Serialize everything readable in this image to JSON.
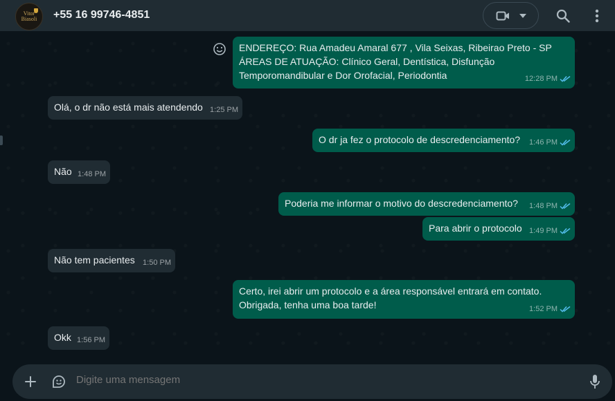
{
  "header": {
    "avatar_text": [
      "Vitor",
      "Biasoli"
    ],
    "contact_name": "+55 16 99746-4851",
    "icons": [
      "video-call-icon",
      "chevron-down-icon",
      "search-icon",
      "more-vert-icon"
    ]
  },
  "messages": [
    {
      "dir": "out",
      "lines": [
        "ENDEREÇO: Rua Amadeu Amaral 677 , Vila Seixas, Ribeirao Preto - SP",
        "ÁREAS DE ATUAÇÃO: Clínico Geral, Dentística, Disfunção",
        "Temporomandibular e Dor Orofacial, Periodontia"
      ],
      "time": "12:28 PM",
      "read": true
    },
    {
      "dir": "in",
      "lines": [
        "Olá, o dr não está mais atendendo"
      ],
      "time": "1:25 PM"
    },
    {
      "dir": "out",
      "lines": [
        "O dr ja fez o protocolo de descredenciamento?"
      ],
      "time": "1:46 PM",
      "read": true
    },
    {
      "dir": "in",
      "lines": [
        "Não"
      ],
      "time": "1:48 PM"
    },
    {
      "dir": "out",
      "lines": [
        "Poderia me informar o motivo do descredenciamento?"
      ],
      "time": "1:48 PM",
      "read": true
    },
    {
      "dir": "out",
      "lines": [
        "Para abrir o protocolo"
      ],
      "time": "1:49 PM",
      "read": true
    },
    {
      "dir": "in",
      "lines": [
        "Não tem pacientes"
      ],
      "time": "1:50 PM"
    },
    {
      "dir": "out",
      "lines": [
        "Certo, irei abrir um protocolo e a área responsável entrará em contato.",
        "Obrigada, tenha uma boa tarde!"
      ],
      "time": "1:52 PM",
      "read": true
    },
    {
      "dir": "in",
      "lines": [
        "Okk"
      ],
      "time": "1:56 PM"
    }
  ],
  "composer": {
    "placeholder": "Digite uma mensagem",
    "icons": [
      "plus-icon",
      "sticker-icon",
      "mic-icon"
    ]
  },
  "colors": {
    "header_bg": "#202c33",
    "chat_bg": "#0b141a",
    "incoming_bubble": "#202c33",
    "outgoing_bubble": "#005c4b",
    "read_ticks": "#53bdeb",
    "muted_text": "#8696a0"
  }
}
